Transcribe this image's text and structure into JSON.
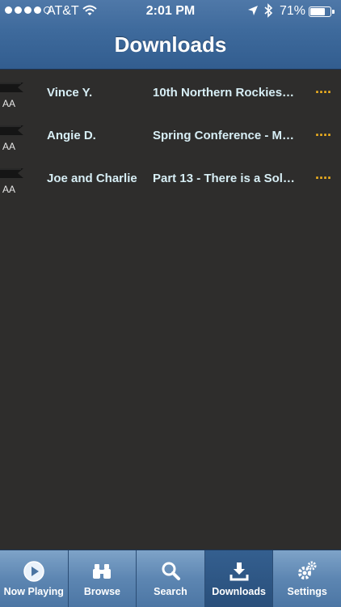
{
  "status_bar": {
    "carrier": "AT&T",
    "time": "2:01 PM",
    "battery_percent": "71%",
    "battery_level": 0.71,
    "signal_filled": 4,
    "signal_total": 5
  },
  "header": {
    "title": "Downloads"
  },
  "downloads": [
    {
      "tag": "AA",
      "speaker": "Vince Y.",
      "talk": "10th Northern Rockies…",
      "more": "····"
    },
    {
      "tag": "AA",
      "speaker": "Angie D.",
      "talk": "Spring Conference - M…",
      "more": "····"
    },
    {
      "tag": "AA",
      "speaker": "Joe and Charlie",
      "talk": "Part 13 - There is a Sol…",
      "more": "····"
    }
  ],
  "tab_bar": {
    "tabs": [
      {
        "label": "Now Playing",
        "icon": "play-circle-icon",
        "active": false
      },
      {
        "label": "Browse",
        "icon": "binoculars-icon",
        "active": false
      },
      {
        "label": "Search",
        "icon": "magnifier-icon",
        "active": false
      },
      {
        "label": "Downloads",
        "icon": "download-tray-icon",
        "active": true
      },
      {
        "label": "Settings",
        "icon": "gears-icon",
        "active": false
      }
    ]
  },
  "colors": {
    "header_blue": "#3e6a9c",
    "background": "#2e2d2c",
    "row_text": "#d7eef5",
    "more_accent": "#f2b21f"
  }
}
